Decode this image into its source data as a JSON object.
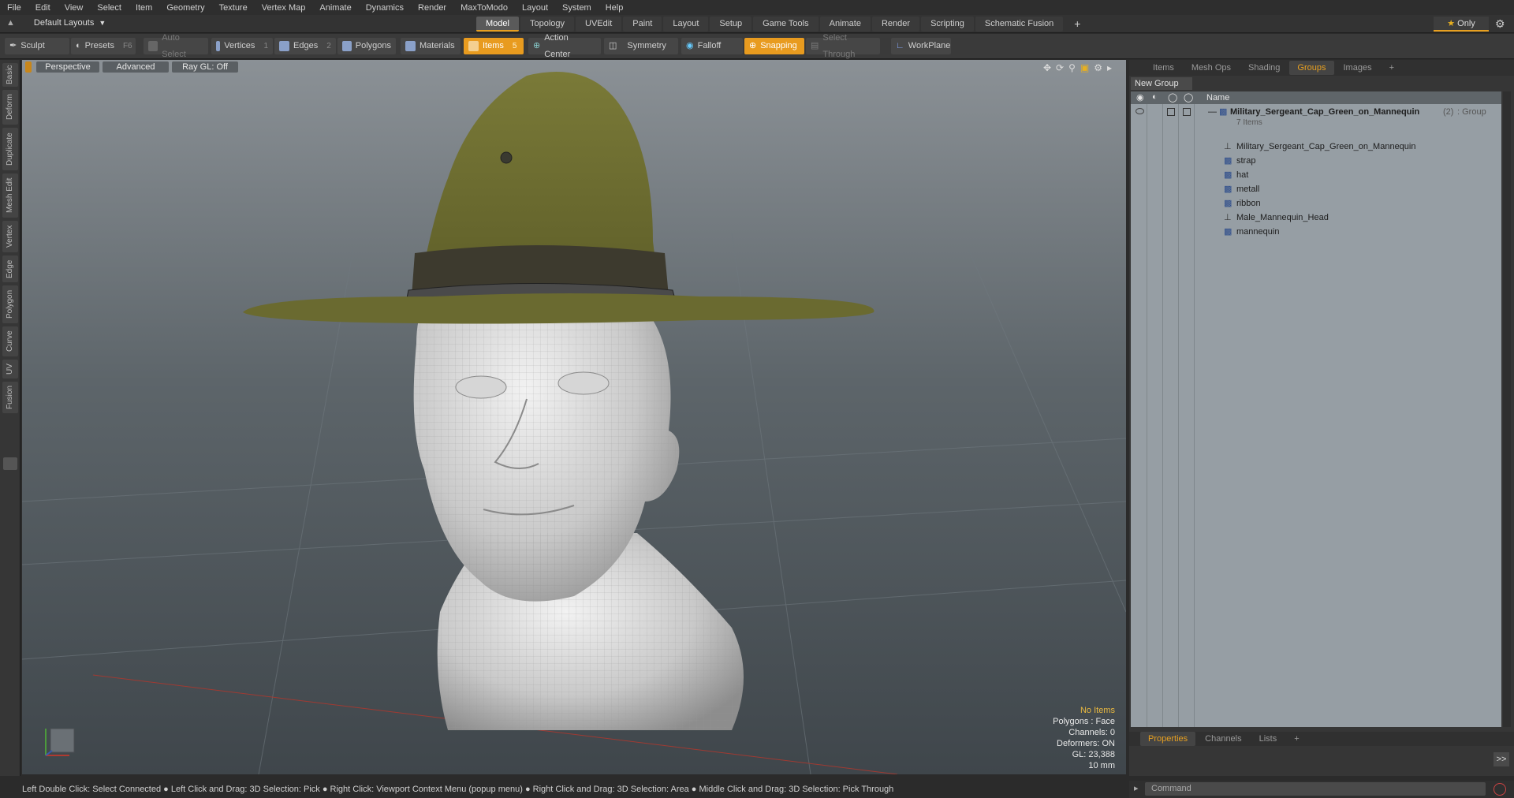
{
  "menu": [
    "File",
    "Edit",
    "View",
    "Select",
    "Item",
    "Geometry",
    "Texture",
    "Vertex Map",
    "Animate",
    "Dynamics",
    "Render",
    "MaxToModo",
    "Layout",
    "System",
    "Help"
  ],
  "layout_selector": "Default Layouts",
  "tabs": [
    "Model",
    "Topology",
    "UVEdit",
    "Paint",
    "Layout",
    "Setup",
    "Game Tools",
    "Animate",
    "Render",
    "Scripting",
    "Schematic Fusion"
  ],
  "only_label": "Only",
  "toolbar": {
    "sculpt": "Sculpt",
    "presets": "Presets",
    "presets_key": "F6",
    "auto_select": "Auto Select",
    "vertices": "Vertices",
    "vertices_key": "1",
    "edges": "Edges",
    "edges_key": "2",
    "polygons": "Polygons",
    "materials": "Materials",
    "items": "Items",
    "items_key": "5",
    "action_center": "Action Center",
    "symmetry": "Symmetry",
    "falloff": "Falloff",
    "snapping": "Snapping",
    "select_through": "Select Through",
    "workplane": "WorkPlane"
  },
  "left_tabs": [
    "Basic",
    "Deform",
    "Duplicate",
    "Mesh Edit",
    "Vertex",
    "Edge",
    "Polygon",
    "Curve",
    "UV",
    "Fusion"
  ],
  "viewport": {
    "view": "Perspective",
    "shading": "Advanced",
    "raygl": "Ray GL: Off",
    "info": {
      "selection": "No Items",
      "polygons": "Polygons : Face",
      "channels": "Channels: 0",
      "deformers": "Deformers: ON",
      "gl": "GL: 23,388",
      "scale": "10 mm"
    }
  },
  "right_tabs": [
    "Items",
    "Mesh Ops",
    "Shading",
    "Groups",
    "Images"
  ],
  "new_group": "New Group",
  "list_header": "Name",
  "group": {
    "name": "Military_Sergeant_Cap_Green_on_Mannequin",
    "count": "(2)",
    "type": ": Group",
    "items_label": "7 Items"
  },
  "items": [
    "Military_Sergeant_Cap_Green_on_Mannequin",
    "strap",
    "hat",
    "metall",
    "ribbon",
    "Male_Mannequin_Head",
    "mannequin"
  ],
  "bottom_tabs": [
    "Properties",
    "Channels",
    "Lists"
  ],
  "command_placeholder": "Command",
  "status_bar": "Left Double Click: Select Connected ● Left Click and Drag: 3D Selection: Pick ● Right Click: Viewport Context Menu (popup menu) ● Right Click and Drag: 3D Selection: Area ● Middle Click and Drag: 3D Selection: Pick Through"
}
